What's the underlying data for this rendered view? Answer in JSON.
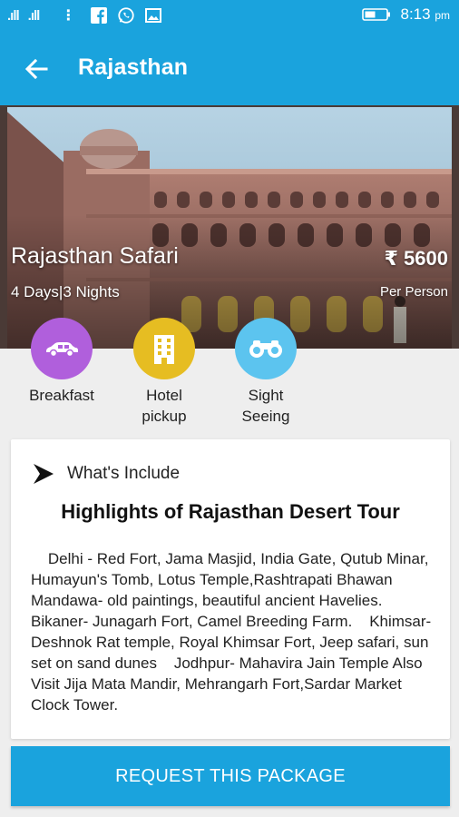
{
  "status_bar": {
    "signal_1": ".ıll",
    "signal_2": ".ıll",
    "menu_dots": "⋮",
    "time": "8:13",
    "ampm": "pm",
    "icons": [
      "facebook-icon",
      "whatsapp-icon",
      "image-icon",
      "battery-icon"
    ]
  },
  "app_bar": {
    "title": "Rajasthan",
    "back_icon": "arrow-back-icon"
  },
  "package": {
    "name": "Rajasthan Safari",
    "duration": "4 Days|3 Nights",
    "price": "₹ 5600",
    "per": "Per Person"
  },
  "amenities": [
    {
      "label": "Breakfast",
      "icon": "car-icon",
      "color": "#b05fdc"
    },
    {
      "label": "Hotel\npickup",
      "icon": "building-icon",
      "color": "#e6bd22"
    },
    {
      "label": "Sight\nSeeing",
      "icon": "binoculars-icon",
      "color": "#5cc4ef"
    }
  ],
  "details": {
    "section_label": "What's Include",
    "heading": "Highlights of Rajasthan Desert Tour",
    "body": "    Delhi - Red Fort, Jama Masjid, India Gate, Qutub Minar, Humayun's Tomb, Lotus Temple,Rashtrapati Bhawan    Mandawa- old paintings, beautiful ancient Havelies.    Bikaner- Junagarh Fort, Camel Breeding Farm.    Khimsar- Deshnok Rat temple, Royal Khimsar Fort, Jeep safari, sun set on sand dunes    Jodhpur- Mahavira Jain Temple Also Visit Jija Mata Mandir, Mehrangarh Fort,Sardar Market Clock Tower."
  },
  "cta": {
    "label": "REQUEST THIS PACKAGE"
  },
  "colors": {
    "primary": "#1aa3dd",
    "background": "#eeeeee"
  }
}
